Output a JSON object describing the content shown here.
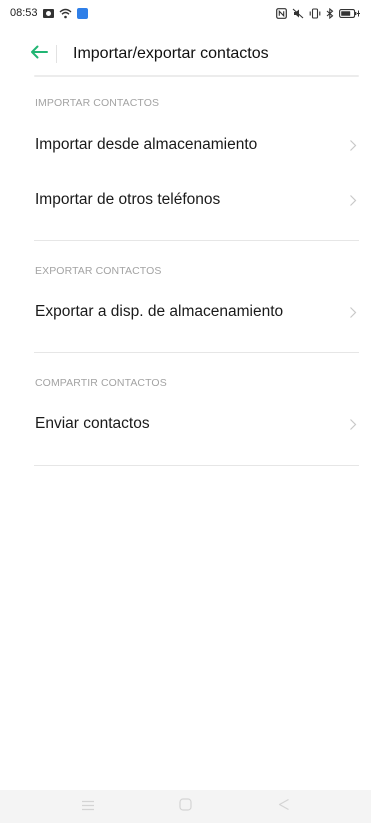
{
  "status_bar": {
    "time": "08:53",
    "icons_left": [
      "notification-icon",
      "wifi-icon",
      "app-badge-icon"
    ],
    "icons_right": [
      "nfc-icon",
      "mute-icon",
      "vibrate-icon",
      "bluetooth-icon",
      "battery-icon"
    ]
  },
  "app_bar": {
    "title": "Importar/exportar contactos",
    "back_icon": "arrow-left-icon",
    "accent_color": "#21b573"
  },
  "sections": [
    {
      "header": "IMPORTAR CONTACTOS",
      "items": [
        {
          "label": "Importar desde almacenamiento"
        },
        {
          "label": "Importar de otros teléfonos"
        }
      ]
    },
    {
      "header": "EXPORTAR CONTACTOS",
      "items": [
        {
          "label": "Exportar a disp. de almacenamiento"
        }
      ]
    },
    {
      "header": "COMPARTIR CONTACTOS",
      "items": [
        {
          "label": "Enviar contactos"
        }
      ]
    }
  ],
  "nav_bar": {
    "buttons": [
      "menu-icon",
      "home-icon",
      "back-triangle-icon"
    ]
  }
}
